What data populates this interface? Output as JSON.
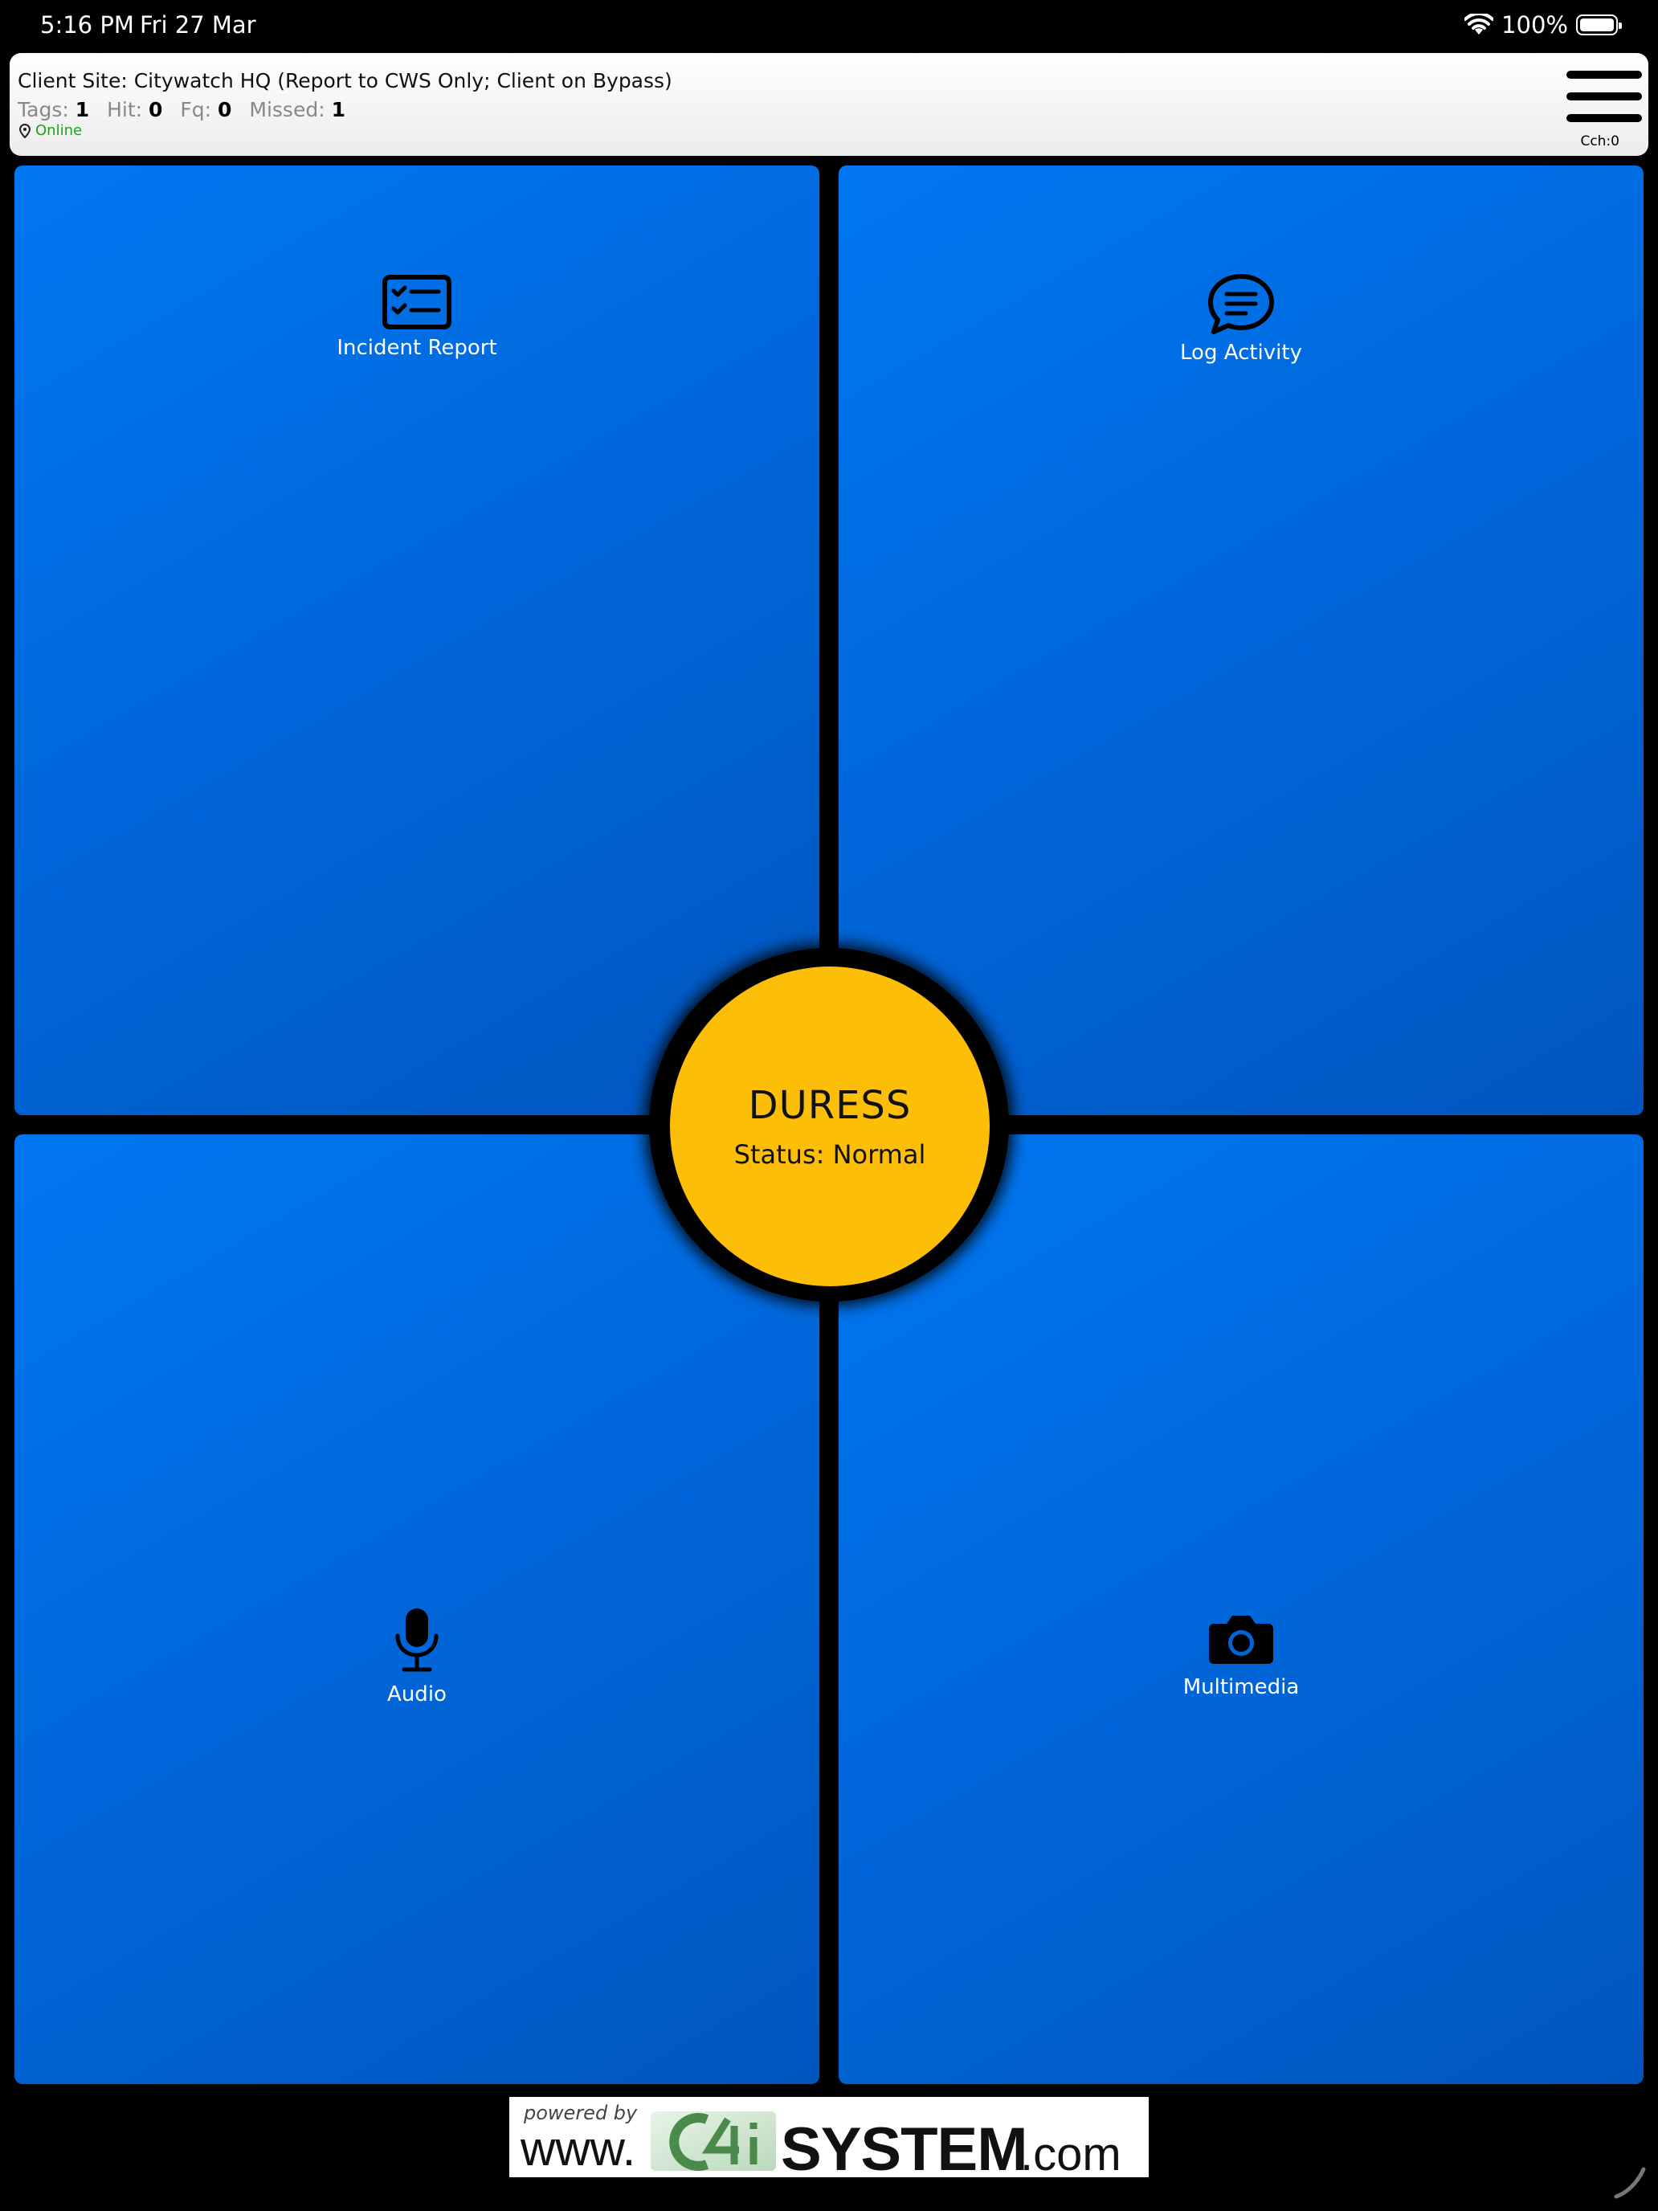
{
  "status_bar": {
    "time": "5:16 PM",
    "date": "Fri 27 Mar",
    "battery": "100%"
  },
  "header": {
    "client_site": "Client Site: Citywatch HQ (Report to CWS Only; Client on Bypass)",
    "stats": {
      "tags_label": "Tags:",
      "tags": "1",
      "hit_label": "Hit:",
      "hit": "0",
      "fq_label": "Fq:",
      "fq": "0",
      "missed_label": "Missed:",
      "missed": "1"
    },
    "connection": "Online",
    "cch": "Cch:0"
  },
  "tiles": {
    "incident_report": "Incident Report",
    "log_activity": "Log Activity",
    "audio": "Audio",
    "multimedia": "Multimedia"
  },
  "duress": {
    "title": "DURESS",
    "status": "Status: Normal"
  },
  "footer": {
    "powered_by": "powered by",
    "www": "www.",
    "system": "SYSTEM",
    "com": ".com"
  },
  "colors": {
    "tile_blue": "#0070e8",
    "duress_yellow": "#fdbe08",
    "online_green": "#1aa31a",
    "background": "#000000"
  },
  "icons": {
    "incident_report": "checklist-icon",
    "log_activity": "chat-bubble-icon",
    "audio": "microphone-icon",
    "multimedia": "camera-icon",
    "menu": "hamburger-menu-icon",
    "connection": "location-pin-icon",
    "wifi": "wifi-icon",
    "battery": "battery-icon"
  }
}
